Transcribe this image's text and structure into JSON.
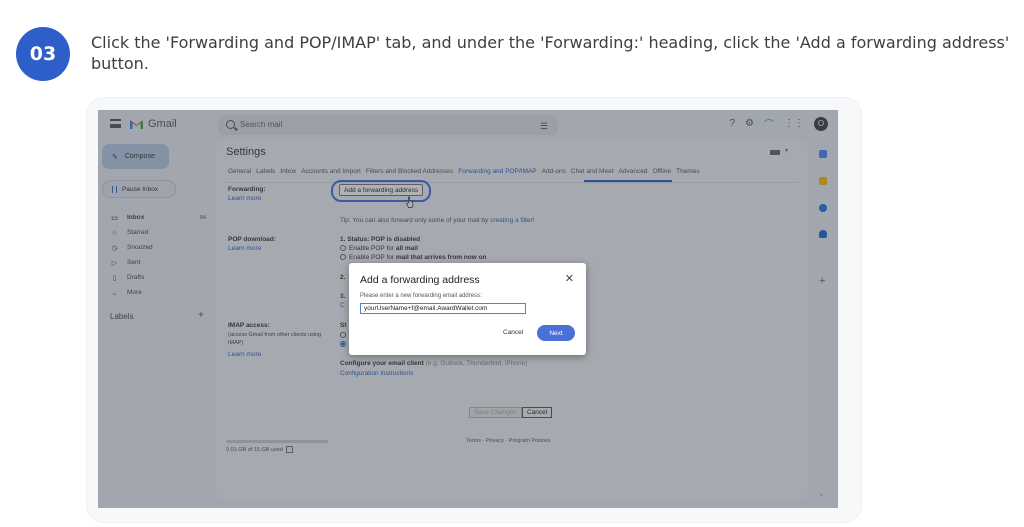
{
  "step": {
    "number": "03",
    "instruction": "Click the 'Forwarding and POP/IMAP' tab, and under the 'Forwarding:' heading, click the 'Add a forwarding address' button."
  },
  "gmail": {
    "app_name": "Gmail",
    "search_placeholder": "Search mail",
    "avatar_initial": "O",
    "compose_label": "Compose",
    "pause_label": "Pause Inbox",
    "nav": [
      {
        "label": "Inbox",
        "count": "84",
        "icon": "inbox-icon"
      },
      {
        "label": "Starred",
        "icon": "star-icon"
      },
      {
        "label": "Snoozed",
        "icon": "clock-icon"
      },
      {
        "label": "Sent",
        "icon": "send-icon"
      },
      {
        "label": "Drafts",
        "icon": "draft-icon"
      },
      {
        "label": "More",
        "icon": "chevron-down-icon"
      }
    ],
    "labels_heading": "Labels",
    "settings_title": "Settings",
    "tabs": [
      "General",
      "Labels",
      "Inbox",
      "Accounts and Import",
      "Filters and Blocked Addresses",
      "Forwarding and POP/IMAP",
      "Add-ons",
      "Chat and Meet",
      "Advanced",
      "Offline",
      "Themes"
    ],
    "forwarding": {
      "label": "Forwarding:",
      "learn_more": "Learn more",
      "button": "Add a forwarding address",
      "tip_prefix": "Tip: You can also forward only some of your mail by ",
      "tip_link": "creating a filter!"
    },
    "pop": {
      "label": "POP download:",
      "learn_more": "Learn more",
      "status": "1. Status: POP is disabled",
      "opt1_prefix": "Enable POP for ",
      "opt1_bold": "all mail",
      "opt2_prefix": "Enable POP for ",
      "opt2_bold": "mail that arrives from now on",
      "step2": "2.",
      "step3": "3.",
      "step3_link": "C"
    },
    "imap": {
      "label": "IMAP access:",
      "sub": "(access Gmail from other clients using IMAP)",
      "learn_more": "Learn more",
      "status": "St",
      "configure_bold": "Configure your email client",
      "configure_rest": " (e.g. Outlook, Thunderbird, iPhone)",
      "config_link": "Configuration instructions"
    },
    "save_changes": "Save Changes",
    "cancel": "Cancel",
    "storage": "0.01 GB of 15 GB used",
    "footer": "Terms · Privacy · Program Policies"
  },
  "dialog": {
    "title": "Add a forwarding address",
    "close": "✕",
    "prompt": "Please enter a new forwarding email address:",
    "input_value": "yourUserName+f@email.AwardWallet.com",
    "cancel": "Cancel",
    "next": "Next"
  },
  "colors": {
    "badge": "#2e5fc9",
    "accent": "#2b5fc7",
    "next_button": "#4a6fd8"
  }
}
